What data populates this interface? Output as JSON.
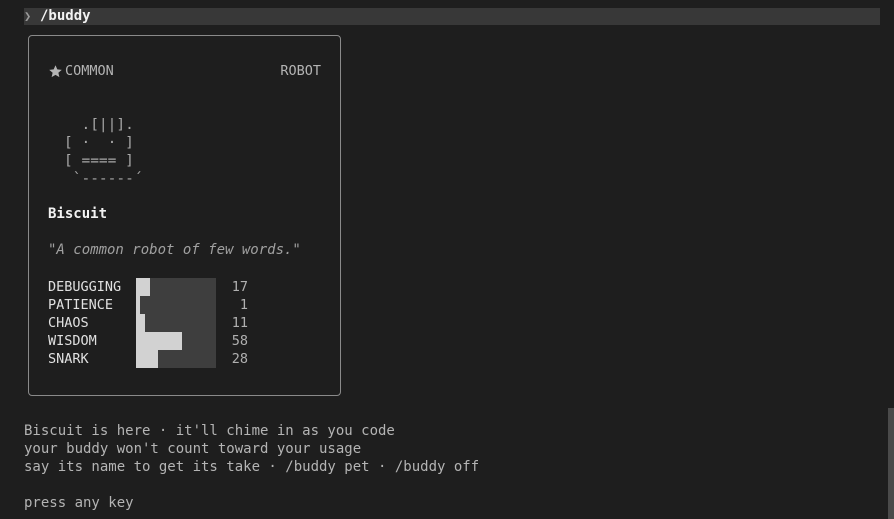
{
  "command": {
    "prompt_glyph": "❯",
    "text": "/buddy"
  },
  "card": {
    "rarity": "COMMON",
    "rarity_icon": "star-icon",
    "species": "ROBOT",
    "art_lines": [
      "  .[||].",
      "[ ·  · ]",
      "[ ==== ]",
      " `------´"
    ],
    "name": "Biscuit",
    "quote": "\"A common robot of few words.\"",
    "stats": [
      {
        "label": "DEBUGGING",
        "value": "17",
        "level": 17
      },
      {
        "label": "PATIENCE",
        "value": "1",
        "level": 1
      },
      {
        "label": "CHAOS",
        "value": "11",
        "level": 11
      },
      {
        "label": "WISDOM",
        "value": "58",
        "level": 58
      },
      {
        "label": "SNARK",
        "value": "28",
        "level": 28
      }
    ],
    "stat_max": 100
  },
  "messages": [
    "Biscuit is here · it'll chime in as you code",
    "your buddy won't count toward your usage",
    "say its name to get its take · /buddy pet · /buddy off"
  ],
  "press_key": "press any key",
  "colors": {
    "background": "#1e1e1e",
    "command_bar": "#383838",
    "bar_fill": "#d2d2d2",
    "card_border": "#8a8a8a"
  }
}
